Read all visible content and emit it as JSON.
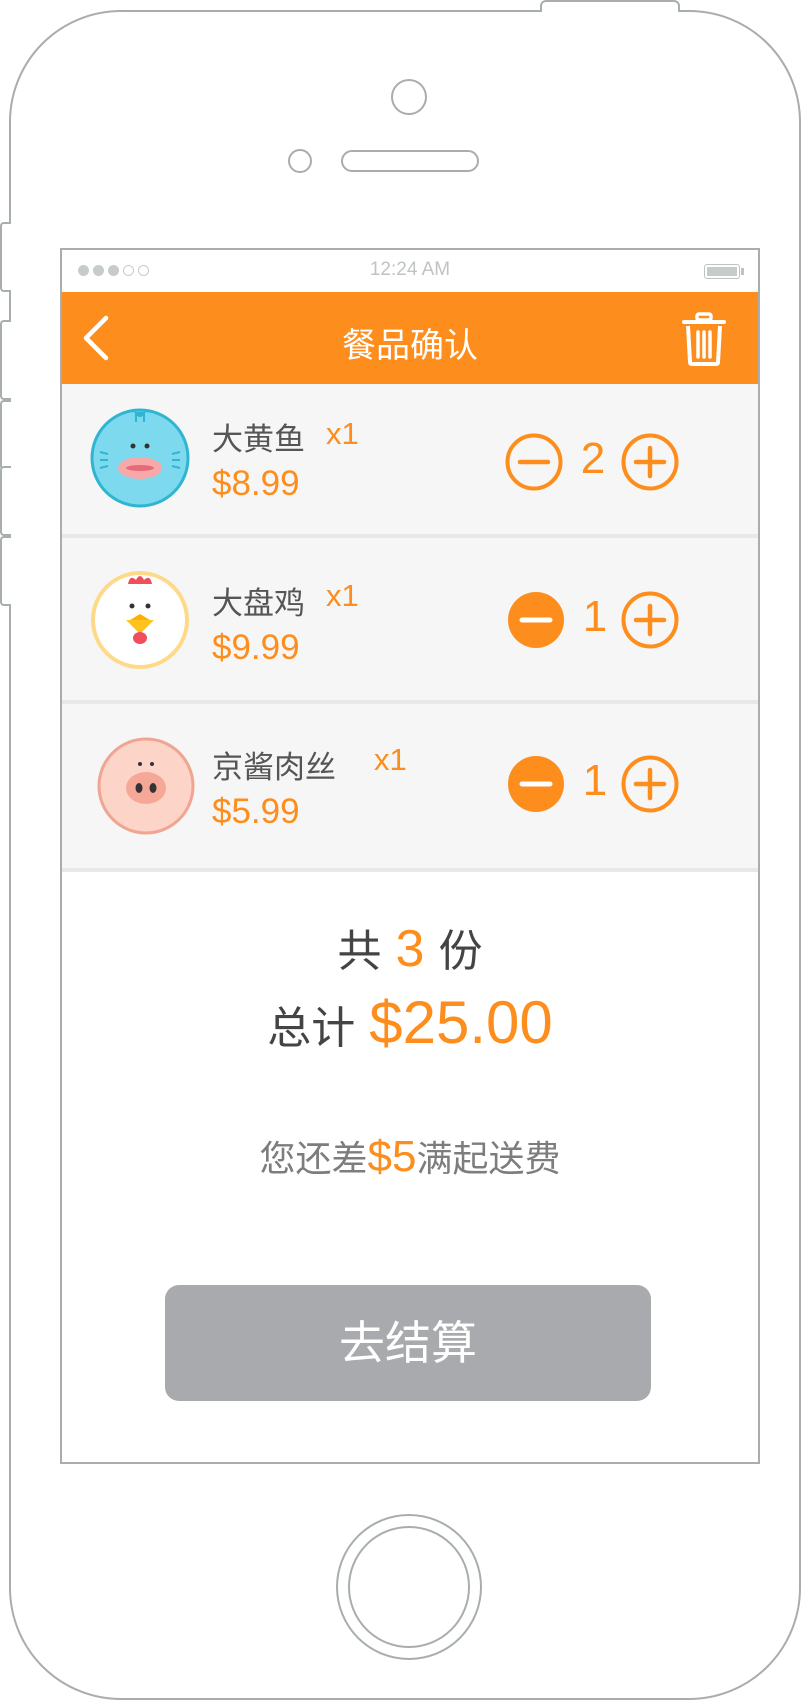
{
  "status_bar": {
    "time": "12:24 AM",
    "signal_dots": [
      "full",
      "full",
      "full",
      "empty",
      "empty"
    ]
  },
  "header": {
    "title": "餐品确认",
    "back_icon": "chevron-left-icon",
    "trash_icon": "trash-icon"
  },
  "cart": {
    "items": [
      {
        "name": "大黄鱼",
        "tag": "x1",
        "price": "$8.99",
        "count": "2",
        "avatar": "fish-avatar",
        "minus_style": "outline"
      },
      {
        "name": "大盘鸡",
        "tag": "x1",
        "price": "$9.99",
        "count": "1",
        "avatar": "chicken-avatar",
        "minus_style": "filled"
      },
      {
        "name": "京酱肉丝",
        "tag": "x1",
        "price": "$5.99",
        "count": "1",
        "avatar": "pig-avatar",
        "minus_style": "filled"
      }
    ]
  },
  "summary": {
    "count_prefix": "共",
    "count_value": "3",
    "count_suffix": "份",
    "total_prefix": "总计",
    "total_value": "$25.00",
    "hint_prefix": "您还差",
    "hint_value": "$5",
    "hint_suffix": "满起送费"
  },
  "checkout": {
    "label": "去结算"
  },
  "colors": {
    "accent": "#fd8d1c",
    "disabled_button": "#a9aaad",
    "row_bg": "#f5f6f5"
  }
}
